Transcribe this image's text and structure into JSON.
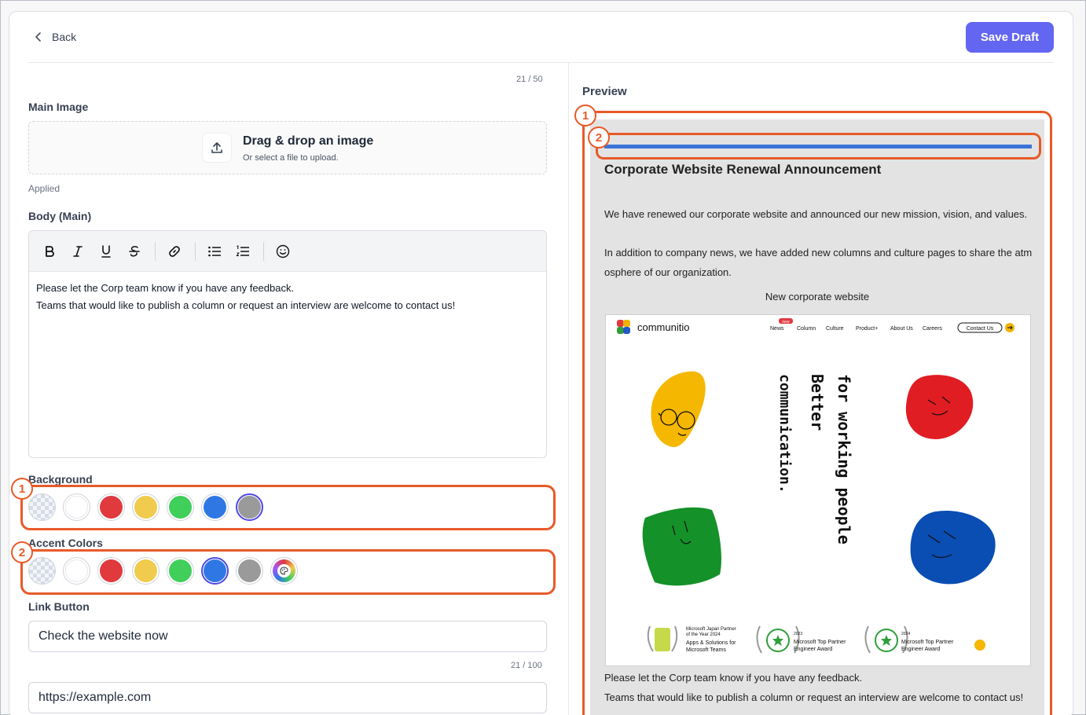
{
  "header": {
    "back_label": "Back",
    "save_label": "Save Draft"
  },
  "form": {
    "title_counter": "21 / 50",
    "main_image_label": "Main Image",
    "dropzone_title": "Drag & drop an image",
    "dropzone_subtitle": "Or select a file to upload.",
    "applied_label": "Applied",
    "body_label": "Body (Main)",
    "body_lines": [
      "Please let the Corp team know if you have any feedback.",
      "Teams that would like to publish a column or request an interview are welcome to contact us!"
    ],
    "toolbar_buttons": [
      "bold",
      "italic",
      "underline",
      "strikethrough",
      "link",
      "bullet-list",
      "numbered-list",
      "emoji"
    ],
    "background_label": "Background",
    "background_colors": [
      {
        "name": "transparent",
        "color": "transparent"
      },
      {
        "name": "white",
        "color": "#ffffff"
      },
      {
        "name": "red",
        "color": "#e0393e"
      },
      {
        "name": "yellow",
        "color": "#f0cb4d"
      },
      {
        "name": "green",
        "color": "#3fcf5a"
      },
      {
        "name": "blue",
        "color": "#2f78e4"
      },
      {
        "name": "gray",
        "color": "#9a9a9a",
        "selected": true
      }
    ],
    "accent_label": "Accent Colors",
    "accent_colors": [
      {
        "name": "transparent",
        "color": "transparent"
      },
      {
        "name": "white",
        "color": "#ffffff"
      },
      {
        "name": "red",
        "color": "#e0393e"
      },
      {
        "name": "yellow",
        "color": "#f0cb4d"
      },
      {
        "name": "green",
        "color": "#3fcf5a"
      },
      {
        "name": "blue",
        "color": "#2f78e4",
        "selected": true
      },
      {
        "name": "gray",
        "color": "#9a9a9a"
      },
      {
        "name": "custom-color-picker",
        "color": "conic"
      }
    ],
    "link_button_label": "Link Button",
    "link_button_value": "Check the website now",
    "link_counter": "21 / 100",
    "url_value": "https://example.com"
  },
  "preview": {
    "heading": "Preview",
    "title": "Corporate Website Renewal Announcement",
    "intro_lines": [
      "We have renewed our corporate website and announced our new mission, vision, and values.",
      "In addition to company news, we have added new columns and culture pages to share the atmosphere of our organization."
    ],
    "image_caption": "New corporate website",
    "image": {
      "logo_text": "communitio",
      "nav": [
        "News",
        "Column",
        "Culture",
        "Product+",
        "About Us",
        "Careers"
      ],
      "nav_badge": "new",
      "contact_label": "Contact Us",
      "vertical_texts": [
        "for working people",
        "Better",
        "communication."
      ],
      "awards": [
        {
          "line1": "Microsoft Japan Partner",
          "line2": "of the Year 2024",
          "line3": "Apps & Solutions for",
          "line4": "Microsoft Teams"
        },
        {
          "line1": "2023",
          "line2": "Microsoft Top Partner",
          "line3": "Engineer Award"
        },
        {
          "line1": "2024",
          "line2": "Microsoft Top Partner",
          "line3": "Engineer Award"
        }
      ]
    },
    "footer_lines": [
      "Please let the Corp team know if you have any feedback.",
      "Teams that would like to publish a column or request an interview are welcome to contact us!"
    ]
  },
  "annotations": {
    "badge_1": "1",
    "badge_2": "2"
  },
  "colors": {
    "highlight": "#e85a28",
    "primary": "#6366f1",
    "accent_bar": "#3b73d9"
  }
}
